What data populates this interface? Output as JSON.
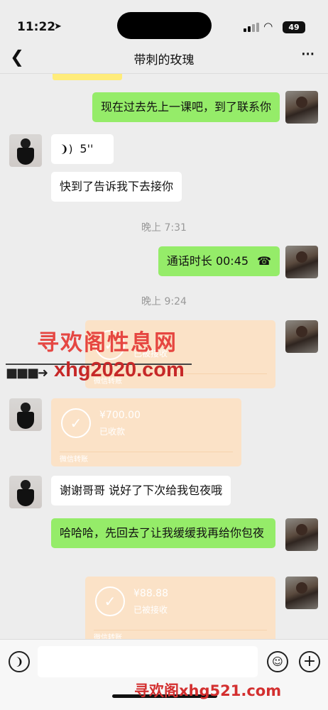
{
  "status_bar": {
    "time": "11:22",
    "battery": "49"
  },
  "header": {
    "title": "带刺的玫瑰"
  },
  "messages": {
    "m1": "现在过去先上一课吧，到了联系你",
    "voice_duration": "5''",
    "m2": "快到了告诉我下去接你",
    "time1": "晚上 7:31",
    "call_label": "通话时长 00:45",
    "time2": "晚上 9:24",
    "transfer1": {
      "amount": "",
      "status": "已被接收",
      "brand": "微信转账"
    },
    "transfer2": {
      "amount": "¥700.00",
      "status": "已收款",
      "brand": "微信转账"
    },
    "m3": "谢谢哥哥 说好了下次给我包夜哦",
    "m4": "哈哈哈，先回去了让我缓缓我再给你包夜",
    "transfer3": {
      "amount": "¥88.88",
      "status": "已被接收",
      "brand": "微信转账"
    }
  },
  "watermark": {
    "main": "寻欢阁性息网",
    "url": "xhg2020.com",
    "bottom": "寻欢阁xhg521.com"
  },
  "icons": {
    "back": "chevron-left-icon",
    "more": "ellipsis-icon",
    "voice": "voice-wave-icon",
    "call": "phone-hangup-icon",
    "check": "check-circle-icon",
    "voice_input": "voice-input-icon",
    "emoji": "emoji-icon",
    "plus": "plus-icon"
  }
}
